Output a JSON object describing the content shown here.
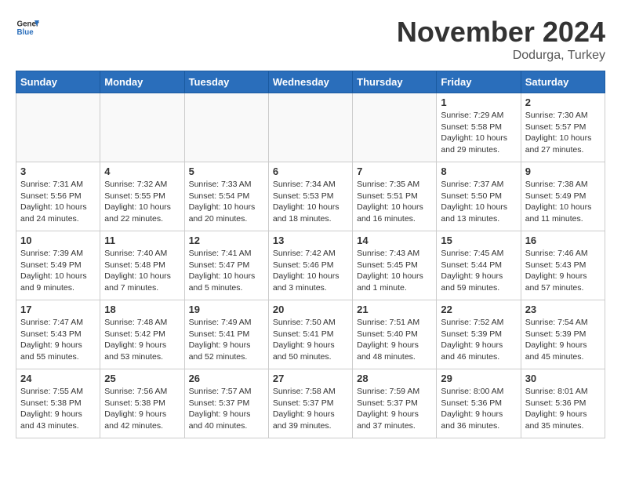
{
  "header": {
    "logo_general": "General",
    "logo_blue": "Blue",
    "month_title": "November 2024",
    "location": "Dodurga, Turkey"
  },
  "weekdays": [
    "Sunday",
    "Monday",
    "Tuesday",
    "Wednesday",
    "Thursday",
    "Friday",
    "Saturday"
  ],
  "weeks": [
    [
      {
        "day": "",
        "info": ""
      },
      {
        "day": "",
        "info": ""
      },
      {
        "day": "",
        "info": ""
      },
      {
        "day": "",
        "info": ""
      },
      {
        "day": "",
        "info": ""
      },
      {
        "day": "1",
        "info": "Sunrise: 7:29 AM\nSunset: 5:58 PM\nDaylight: 10 hours\nand 29 minutes."
      },
      {
        "day": "2",
        "info": "Sunrise: 7:30 AM\nSunset: 5:57 PM\nDaylight: 10 hours\nand 27 minutes."
      }
    ],
    [
      {
        "day": "3",
        "info": "Sunrise: 7:31 AM\nSunset: 5:56 PM\nDaylight: 10 hours\nand 24 minutes."
      },
      {
        "day": "4",
        "info": "Sunrise: 7:32 AM\nSunset: 5:55 PM\nDaylight: 10 hours\nand 22 minutes."
      },
      {
        "day": "5",
        "info": "Sunrise: 7:33 AM\nSunset: 5:54 PM\nDaylight: 10 hours\nand 20 minutes."
      },
      {
        "day": "6",
        "info": "Sunrise: 7:34 AM\nSunset: 5:53 PM\nDaylight: 10 hours\nand 18 minutes."
      },
      {
        "day": "7",
        "info": "Sunrise: 7:35 AM\nSunset: 5:51 PM\nDaylight: 10 hours\nand 16 minutes."
      },
      {
        "day": "8",
        "info": "Sunrise: 7:37 AM\nSunset: 5:50 PM\nDaylight: 10 hours\nand 13 minutes."
      },
      {
        "day": "9",
        "info": "Sunrise: 7:38 AM\nSunset: 5:49 PM\nDaylight: 10 hours\nand 11 minutes."
      }
    ],
    [
      {
        "day": "10",
        "info": "Sunrise: 7:39 AM\nSunset: 5:49 PM\nDaylight: 10 hours\nand 9 minutes."
      },
      {
        "day": "11",
        "info": "Sunrise: 7:40 AM\nSunset: 5:48 PM\nDaylight: 10 hours\nand 7 minutes."
      },
      {
        "day": "12",
        "info": "Sunrise: 7:41 AM\nSunset: 5:47 PM\nDaylight: 10 hours\nand 5 minutes."
      },
      {
        "day": "13",
        "info": "Sunrise: 7:42 AM\nSunset: 5:46 PM\nDaylight: 10 hours\nand 3 minutes."
      },
      {
        "day": "14",
        "info": "Sunrise: 7:43 AM\nSunset: 5:45 PM\nDaylight: 10 hours\nand 1 minute."
      },
      {
        "day": "15",
        "info": "Sunrise: 7:45 AM\nSunset: 5:44 PM\nDaylight: 9 hours\nand 59 minutes."
      },
      {
        "day": "16",
        "info": "Sunrise: 7:46 AM\nSunset: 5:43 PM\nDaylight: 9 hours\nand 57 minutes."
      }
    ],
    [
      {
        "day": "17",
        "info": "Sunrise: 7:47 AM\nSunset: 5:43 PM\nDaylight: 9 hours\nand 55 minutes."
      },
      {
        "day": "18",
        "info": "Sunrise: 7:48 AM\nSunset: 5:42 PM\nDaylight: 9 hours\nand 53 minutes."
      },
      {
        "day": "19",
        "info": "Sunrise: 7:49 AM\nSunset: 5:41 PM\nDaylight: 9 hours\nand 52 minutes."
      },
      {
        "day": "20",
        "info": "Sunrise: 7:50 AM\nSunset: 5:41 PM\nDaylight: 9 hours\nand 50 minutes."
      },
      {
        "day": "21",
        "info": "Sunrise: 7:51 AM\nSunset: 5:40 PM\nDaylight: 9 hours\nand 48 minutes."
      },
      {
        "day": "22",
        "info": "Sunrise: 7:52 AM\nSunset: 5:39 PM\nDaylight: 9 hours\nand 46 minutes."
      },
      {
        "day": "23",
        "info": "Sunrise: 7:54 AM\nSunset: 5:39 PM\nDaylight: 9 hours\nand 45 minutes."
      }
    ],
    [
      {
        "day": "24",
        "info": "Sunrise: 7:55 AM\nSunset: 5:38 PM\nDaylight: 9 hours\nand 43 minutes."
      },
      {
        "day": "25",
        "info": "Sunrise: 7:56 AM\nSunset: 5:38 PM\nDaylight: 9 hours\nand 42 minutes."
      },
      {
        "day": "26",
        "info": "Sunrise: 7:57 AM\nSunset: 5:37 PM\nDaylight: 9 hours\nand 40 minutes."
      },
      {
        "day": "27",
        "info": "Sunrise: 7:58 AM\nSunset: 5:37 PM\nDaylight: 9 hours\nand 39 minutes."
      },
      {
        "day": "28",
        "info": "Sunrise: 7:59 AM\nSunset: 5:37 PM\nDaylight: 9 hours\nand 37 minutes."
      },
      {
        "day": "29",
        "info": "Sunrise: 8:00 AM\nSunset: 5:36 PM\nDaylight: 9 hours\nand 36 minutes."
      },
      {
        "day": "30",
        "info": "Sunrise: 8:01 AM\nSunset: 5:36 PM\nDaylight: 9 hours\nand 35 minutes."
      }
    ]
  ]
}
